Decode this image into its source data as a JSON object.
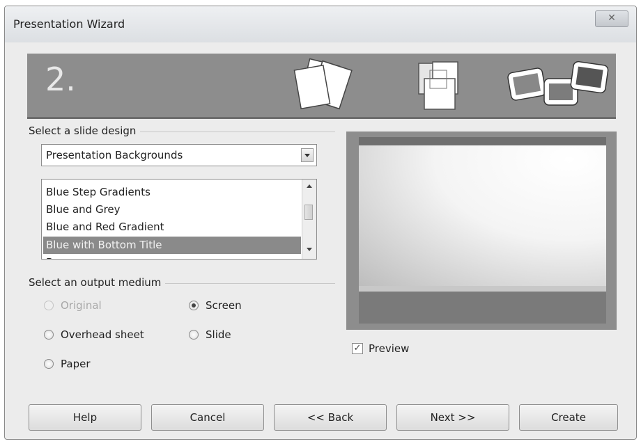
{
  "window": {
    "title": "Presentation Wizard",
    "close_label": "✕"
  },
  "banner": {
    "step": "2."
  },
  "design": {
    "group_label": "Select a slide design",
    "combo_value": "Presentation Backgrounds",
    "list_items": [
      "Blue Step Gradients",
      "Blue and Grey",
      "Blue and Red Gradient",
      "Blue with Bottom Title",
      "Brown"
    ],
    "selected_item": "Blue with Bottom Title"
  },
  "output": {
    "group_label": "Select an output medium",
    "options": [
      {
        "label": "Original",
        "selected": false,
        "disabled": true
      },
      {
        "label": "Screen",
        "selected": true,
        "disabled": false
      },
      {
        "label": "Overhead sheet",
        "selected": false,
        "disabled": false
      },
      {
        "label": "Slide",
        "selected": false,
        "disabled": false
      },
      {
        "label": "Paper",
        "selected": false,
        "disabled": false
      }
    ]
  },
  "preview": {
    "checkbox_label": "Preview",
    "checked": true
  },
  "buttons": {
    "help": "Help",
    "cancel": "Cancel",
    "back": "<< Back",
    "next": "Next >>",
    "create": "Create"
  }
}
